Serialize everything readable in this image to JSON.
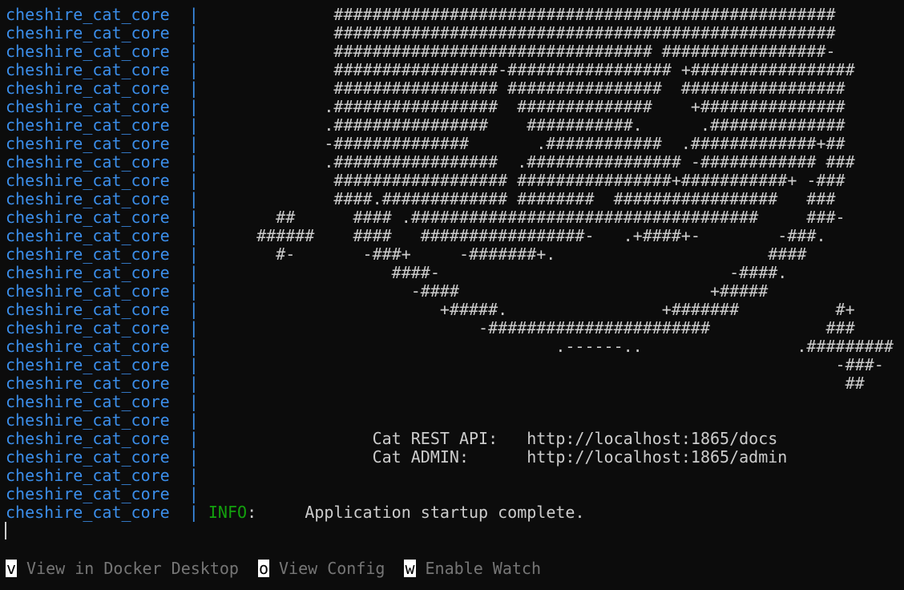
{
  "service_prefix": "cheshire_cat_core",
  "separator": "|",
  "lines": [
    "             ####################################################",
    "             ####################################################",
    "             ################################# #################-",
    "             #################-################# +#################",
    "             ################# ################  #################",
    "            .#################  ##############    +###############",
    "            .################    ###########.      .##############",
    "            -##############       .############  .#############+##",
    "            .#################  .################ -############ ###",
    "             ################## ################+###########+ -###",
    "             ####.############# ########  #################   ###",
    "       ##      #### .####################################     ###-",
    "     ######    ####   #################-   .+####+-        -###.",
    "       #-       -###+     -#######+.                      ####",
    "                   ####-                              -####.",
    "                     -####                          +#####",
    "                        +#####.                +#######          #+",
    "                            -#######################            ###",
    "                                    .------..                .#########",
    "                                                                 -###-",
    "                                                                  ##",
    "",
    "",
    "                 Cat REST API:   http://localhost:1865/docs",
    "                 Cat ADMIN:      http://localhost:1865/admin",
    "",
    ""
  ],
  "final_line": {
    "level": "INFO",
    "colon": ":",
    "message": "     Application startup complete."
  },
  "shortcuts": [
    {
      "key": "v",
      "label": "View in Docker Desktop"
    },
    {
      "key": "o",
      "label": "View Config"
    },
    {
      "key": "w",
      "label": "Enable Watch"
    }
  ],
  "colors": {
    "background": "#0c0c0c",
    "prefix": "#3b8eea",
    "text": "#cccccc",
    "info": "#13a10e",
    "shortcut_label": "#767676"
  }
}
